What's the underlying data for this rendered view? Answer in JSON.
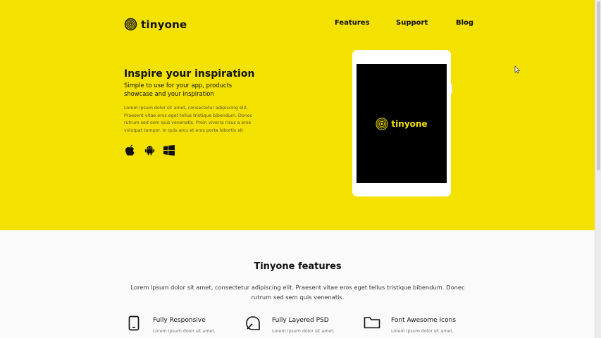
{
  "brand": {
    "name": "tinyone"
  },
  "nav": [
    {
      "label": "Features"
    },
    {
      "label": "Support"
    },
    {
      "label": "Blog"
    }
  ],
  "hero": {
    "title": "Inspire your inspiration",
    "subtitle": "Simple to use for your app, products showcase and your inspiration",
    "body": "Lorem ipsum dolor sit amet, consectetur adipiscing elit. Praesent vitae eros eget tellus tristique bibendum. Donec rutrum sed sem quis venenatis. Proin viverra risus a eros volutpat tempor. In quis arcu et eros porta lobortis sit",
    "platforms": [
      "apple-icon",
      "android-icon",
      "windows-icon"
    ]
  },
  "device_screen": {
    "logo_text": "tinyone"
  },
  "features": {
    "title": "Tinyone features",
    "description": "Lorem ipsum dolor sit amet, consectetur adipiscing elit. Praesent vitae eros eget tellus tristique bibendum. Donec rutrum sed sem quis venenatis.",
    "items": [
      {
        "icon": "tablet-icon",
        "title": "Fully Responsive",
        "text": "Lorem ipsum dolor sit amet,"
      },
      {
        "icon": "leaf-icon",
        "title": "Fully Layered PSD",
        "text": "Lorem ipsum dolor sit amet,"
      },
      {
        "icon": "folder-icon",
        "title": "Font Awesome Icons",
        "text": "Lorem ipsum dolor sit amet,"
      }
    ]
  },
  "colors": {
    "accent": "#f3e100",
    "dark": "#000000",
    "light": "#fafafa"
  }
}
